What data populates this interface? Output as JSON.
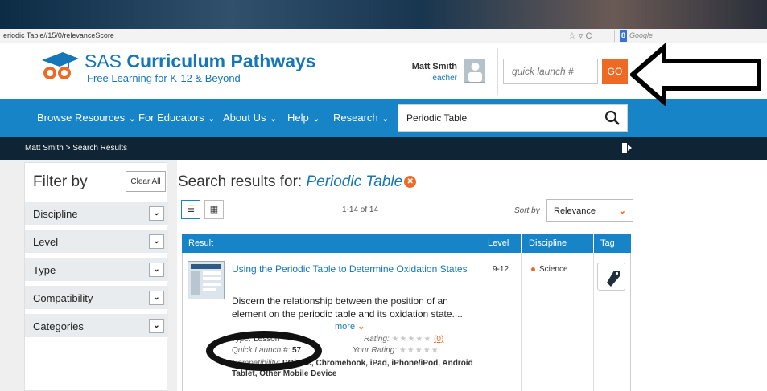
{
  "browser": {
    "url": "eriodic Table//15/0/relevanceScore",
    "search_engine_label": "Google",
    "search_engine_icon": "8"
  },
  "header": {
    "logo_title_bold": "SAS",
    "logo_title_rest": "Curriculum Pathways",
    "logo_sub": "Free Learning for K-12 & Beyond",
    "user_name": "Matt Smith",
    "user_role": "Teacher",
    "quick_launch_placeholder": "quick launch #",
    "go_label": "GO"
  },
  "nav": {
    "items": [
      "Browse Resources",
      "For Educators",
      "About Us",
      "Help",
      "Research"
    ],
    "search_value": "Periodic Table"
  },
  "breadcrumb": {
    "user": "Matt Smith",
    "separator": ">",
    "current": "Search Results"
  },
  "filter": {
    "title": "Filter by",
    "clear_label": "Clear All",
    "items": [
      "Discipline",
      "Level",
      "Type",
      "Compatibility",
      "Categories"
    ]
  },
  "results": {
    "heading_prefix": "Search results for:",
    "query": "Periodic Table",
    "count": "1-14 of 14",
    "sort_label": "Sort by",
    "sort_value": "Relevance",
    "columns": [
      "Result",
      "Level",
      "Discipline",
      "Tag"
    ],
    "items": [
      {
        "title": "Using the Periodic Table to Determine Oxidation States",
        "description": "Discern the relationship between the position of an element on the periodic table and its oxidation state....",
        "more_label": "more",
        "type_label": "Type:",
        "type_value": "Lesson",
        "quick_launch_label": "Quick Launch #:",
        "quick_launch_value": "57",
        "compat_label": "Compatibility:",
        "compat_value": "PC/Mac, Chromebook, iPad, iPhone/iPod, Android Tablet, Other Mobile Device",
        "rating_label": "Rating:",
        "rating_count": "(0)",
        "your_rating_label": "Your Rating:",
        "level": "9-12",
        "discipline": "Science"
      }
    ]
  },
  "colors": {
    "brand_blue": "#1784c7",
    "accent_orange": "#ee6a24",
    "dark_bar": "#0f2434"
  }
}
